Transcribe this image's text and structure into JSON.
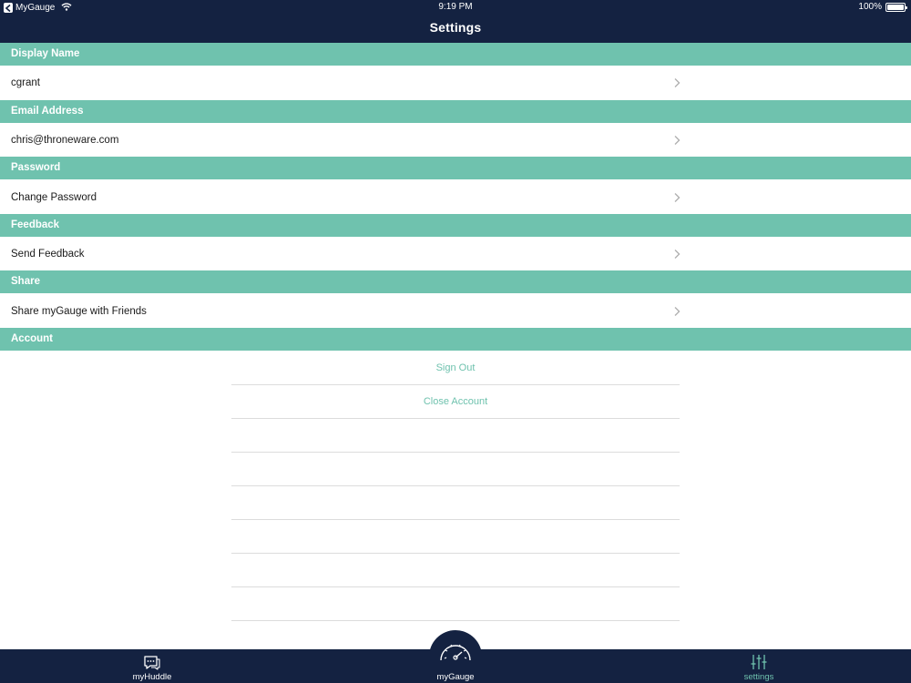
{
  "status_bar": {
    "back_app": "MyGauge",
    "time": "9:19 PM",
    "battery": "100%",
    "battery_level": 1.0
  },
  "header": {
    "title": "Settings"
  },
  "sections": [
    {
      "header": "Display Name",
      "value": "cgrant"
    },
    {
      "header": "Email Address",
      "value": "chris@throneware.com"
    },
    {
      "header": "Password",
      "value": "Change Password"
    },
    {
      "header": "Feedback",
      "value": "Send Feedback"
    },
    {
      "header": "Share",
      "value": "Share myGauge with Friends"
    }
  ],
  "account": {
    "header": "Account",
    "sign_out": "Sign Out",
    "close_account": "Close Account"
  },
  "tabbar": {
    "tabs": [
      {
        "label": "myHuddle",
        "icon": "chat-icon"
      },
      {
        "label": "myGauge",
        "icon": "gauge-icon"
      },
      {
        "label": "settings",
        "icon": "sliders-icon"
      }
    ],
    "active": "settings"
  },
  "colors": {
    "navy": "#142241",
    "accent": "#6fc2ae"
  }
}
